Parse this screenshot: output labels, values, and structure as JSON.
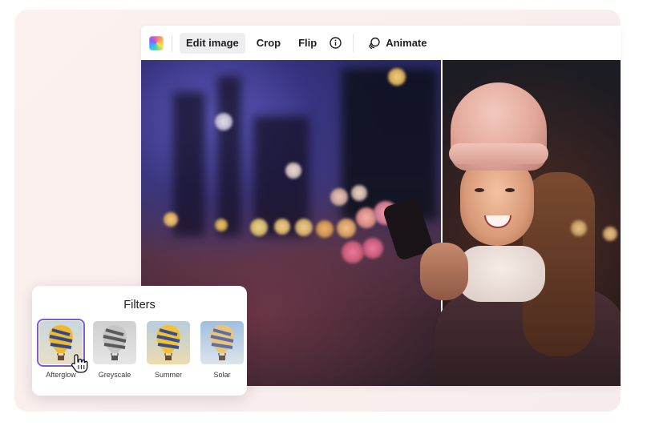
{
  "toolbar": {
    "edit_image": "Edit image",
    "crop": "Crop",
    "flip": "Flip",
    "info_icon": "info-icon",
    "animate": "Animate",
    "animate_icon": "animate-icon",
    "active_tab": "Edit image"
  },
  "filters": {
    "title": "Filters",
    "items": [
      {
        "label": "Afterglow",
        "selected": true
      },
      {
        "label": "Greyscale",
        "selected": false
      },
      {
        "label": "Summer",
        "selected": false
      },
      {
        "label": "Solar",
        "selected": false
      }
    ]
  },
  "colors": {
    "accent": "#7d5bd6",
    "active_tab_bg": "#eeeef1"
  }
}
